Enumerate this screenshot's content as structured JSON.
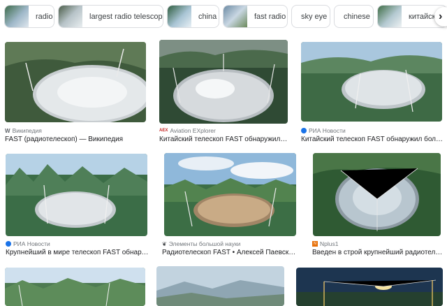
{
  "chips": [
    {
      "label": "radio",
      "has_thumb": true
    },
    {
      "label": "largest radio telescope",
      "has_thumb": true
    },
    {
      "label": "china",
      "has_thumb": true
    },
    {
      "label": "fast radio",
      "has_thumb": true
    },
    {
      "label": "sky eye",
      "has_thumb": false
    },
    {
      "label": "chinese",
      "has_thumb": false
    },
    {
      "label": "китайский",
      "has_thumb": true
    }
  ],
  "next_icon": "chevron-right-icon",
  "results": [
    {
      "source": "Википедия",
      "title": "FAST (радиотелескоп) — Википедия",
      "favicon": "W",
      "favicon_color": "#5f6368"
    },
    {
      "source": "Aviation EXplorer",
      "title": "Китайский телескоп FAST обнаружил н...",
      "favicon": "AEX",
      "favicon_color": "#c5221f"
    },
    {
      "source": "РИА Новости",
      "title": "Китайский телескоп FAST обнаружил боле...",
      "favicon": "globe",
      "favicon_color": "#1a73e8"
    },
    {
      "source": "РИА Новости",
      "title": "Крупнейший в мире телескоп FAST обнаруж...",
      "favicon": "globe",
      "favicon_color": "#1a73e8"
    },
    {
      "source": "Элементы большой науки",
      "title": "Радиотелескоп FAST • Алексей Паевский...",
      "favicon": "leaf",
      "favicon_color": "#3c4043"
    },
    {
      "source": "Nplus1",
      "title": "Введен в строй крупнейший радиотеле...",
      "favicon": "N+1",
      "favicon_color": "#e8710a"
    }
  ],
  "colors": {
    "chip_border": "#dadce0",
    "source_text": "#70757a",
    "title_text": "#202124"
  }
}
